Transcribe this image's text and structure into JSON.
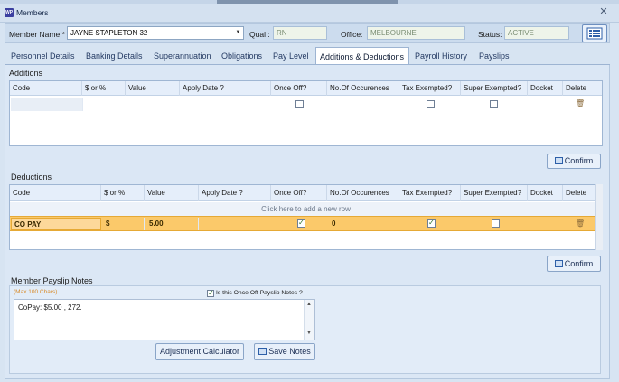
{
  "window": {
    "title": "Members",
    "app_icon": "WP"
  },
  "header": {
    "member_label": "Member Name *",
    "member_value": "JAYNE STAPLETON 32",
    "qual_label": "Qual :",
    "qual_value": "RN",
    "office_label": "Office:",
    "office_value": "MELBOURNE",
    "status_label": "Status:",
    "status_value": "ACTIVE"
  },
  "tabs": [
    {
      "label": "Personnel Details"
    },
    {
      "label": "Banking Details"
    },
    {
      "label": "Superannuation"
    },
    {
      "label": "Obligations"
    },
    {
      "label": "Pay Level"
    },
    {
      "label": "Additions & Deductions",
      "active": true
    },
    {
      "label": "Payroll History"
    },
    {
      "label": "Payslips"
    }
  ],
  "additions": {
    "title": "Additions",
    "columns": [
      "Code",
      "$ or %",
      "Value",
      "Apply Date ?",
      "Once Off?",
      "No.Of Occurences",
      "Tax Exempted?",
      "Super Exempted?",
      "Docket",
      "Delete"
    ],
    "rows": [
      {
        "code": "",
        "unit": "",
        "value": "",
        "apply_date": "",
        "once_off": false,
        "occurences": "",
        "tax_exempted": false,
        "super_exempted": false,
        "docket": ""
      }
    ],
    "confirm_label": "Confirm"
  },
  "deductions": {
    "title": "Deductions",
    "columns": [
      "Code",
      "$ or %",
      "Value",
      "Apply Date ?",
      "Once Off?",
      "No.Of Occurences",
      "Tax Exempted?",
      "Super Exempted?",
      "Docket",
      "Delete"
    ],
    "add_row_text": "Click here to add a new row",
    "rows": [
      {
        "code": "CO PAY",
        "unit": "$",
        "value": "5.00",
        "apply_date": "",
        "once_off": true,
        "occurences": "0",
        "tax_exempted": true,
        "super_exempted": false,
        "docket": ""
      }
    ],
    "confirm_label": "Confirm"
  },
  "notes": {
    "title": "Member Payslip Notes",
    "max_chars": "(Max 100 Chars)",
    "once_off_label": "Is this Once Off Payslip Notes ?",
    "once_off_checked": true,
    "text": "CoPay: $5.00 , 272.",
    "adjustment_label": "Adjustment Calculator",
    "save_label": "Save Notes"
  },
  "colors": {
    "selected_row": "#fbc96a",
    "accent": "#2d5fa8"
  }
}
